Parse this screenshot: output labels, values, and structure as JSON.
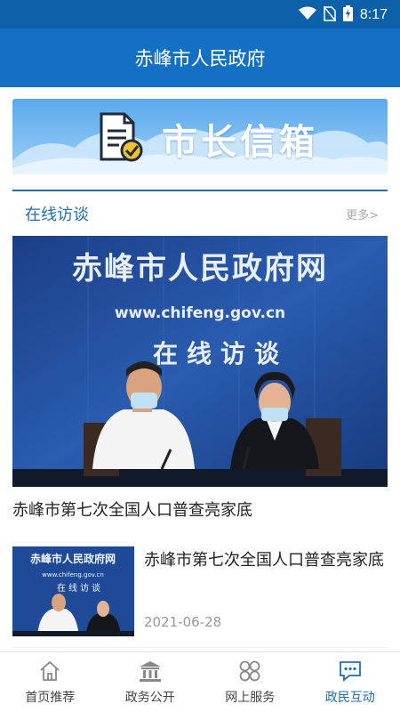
{
  "status_bar": {
    "time": "8:17",
    "icons": [
      "wifi-icon",
      "no-sim-icon",
      "battery-charging-icon"
    ]
  },
  "header": {
    "title": "赤峰市人民政府"
  },
  "banner": {
    "title": "市长信箱",
    "icon": "document-check-icon"
  },
  "section": {
    "title": "在线访谈",
    "more_label": "更多>"
  },
  "hero": {
    "caption": "赤峰市第七次全国人口普查亮家底",
    "backdrop_title": "赤峰市人民政府网",
    "backdrop_url": "www.chifeng.gov.cn",
    "backdrop_subtitle": "在线访谈"
  },
  "news": [
    {
      "title": "赤峰市第七次全国人口普查亮家底",
      "date": "2021-06-28",
      "thumb_title": "赤峰市人民政府网",
      "thumb_url": "www.chifeng.gov.cn",
      "thumb_subtitle": "在线访谈"
    }
  ],
  "tabs": [
    {
      "label": "首页推荐",
      "icon": "home-icon",
      "active": false
    },
    {
      "label": "政务公开",
      "icon": "government-building-icon",
      "active": false
    },
    {
      "label": "网上服务",
      "icon": "services-grid-icon",
      "active": false
    },
    {
      "label": "政民互动",
      "icon": "chat-bubble-icon",
      "active": true
    }
  ],
  "colors": {
    "primary": "#1470c3",
    "statusbar": "#0d61a8",
    "accent": "#1e6fb8",
    "inactive": "#444444"
  }
}
